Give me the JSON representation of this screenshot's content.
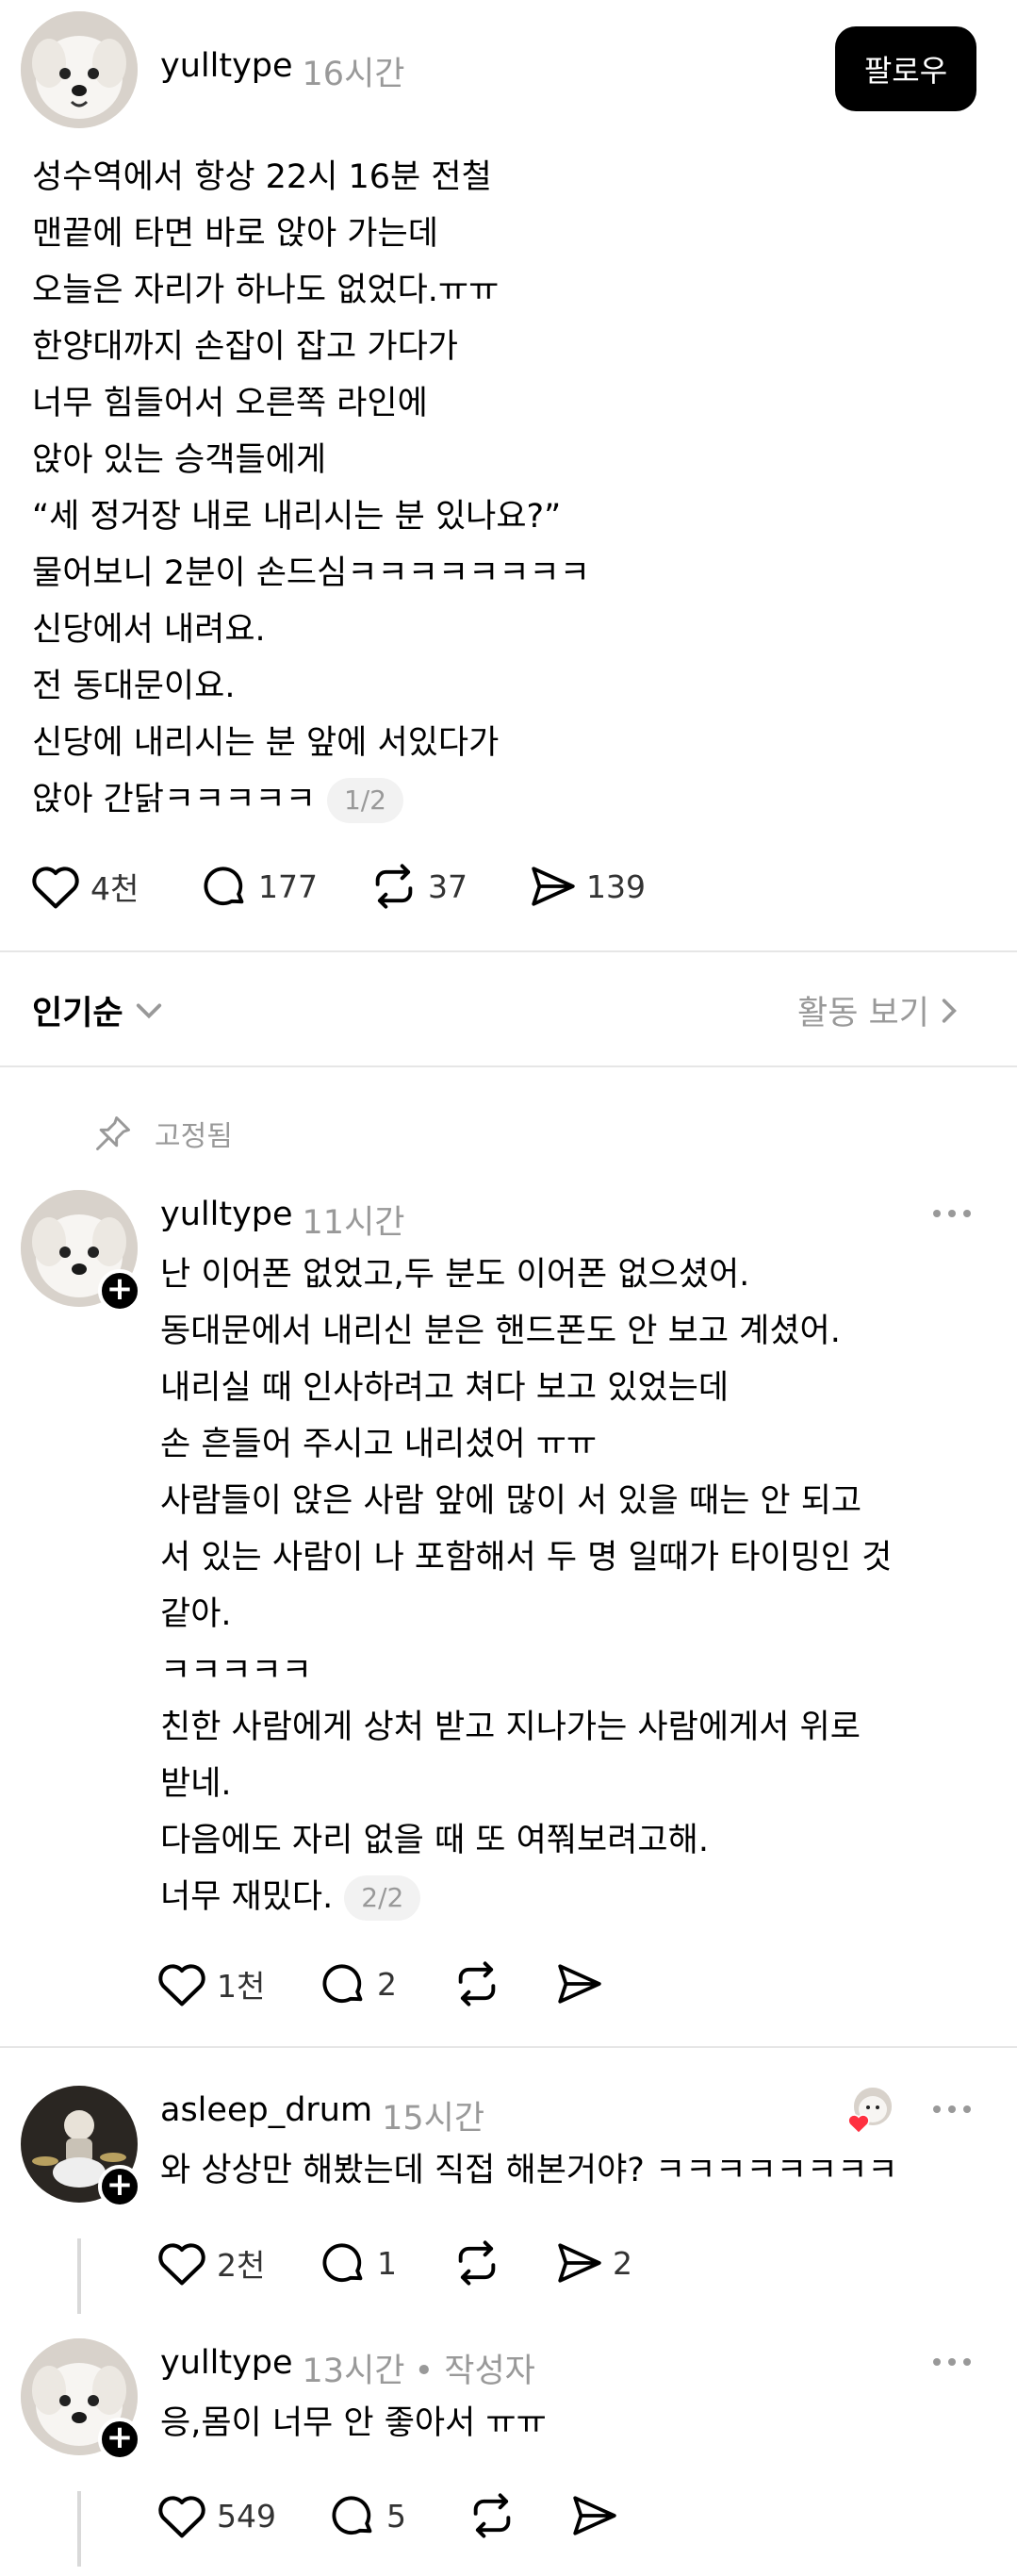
{
  "post": {
    "username": "yulltype",
    "time": "16시간",
    "follow_label": "팔로우",
    "lines": [
      "성수역에서 항상 22시 16분 전철",
      "맨끝에 타면 바로 앉아 가는데",
      "오늘은 자리가 하나도 없었다.ㅠㅠ",
      "한양대까지 손잡이 잡고 가다가",
      "너무 힘들어서 오른쪽 라인에",
      "앉아 있는 승객들에게",
      "“세 정거장 내로 내리시는 분 있나요?”",
      "물어보니 2분이 손드심ㅋㅋㅋㅋㅋㅋㅋㅋ",
      "신당에서 내려요.",
      "전 동대문이요.",
      "신당에 내리시는 분 앞에 서있다가",
      "앉아 간닭ㅋㅋㅋㅋㅋ"
    ],
    "pager": "1/2",
    "likes": "4천",
    "comments": "177",
    "reposts": "37",
    "shares": "139"
  },
  "sort_bar": {
    "sort_label": "인기순",
    "activity_label": "활동 보기"
  },
  "pinned_label": "고정됨",
  "replies": [
    {
      "username": "yulltype",
      "time": "11시간",
      "lines": [
        "난 이어폰 없었고,두 분도 이어폰 없으셨어.",
        "동대문에서 내리신 분은 핸드폰도 안 보고 계셨어.",
        "내리실 때 인사하려고 쳐다 보고 있었는데",
        "손 흔들어 주시고 내리셨어 ㅠㅠ",
        "사람들이 앉은 사람 앞에 많이 서 있을 때는 안 되고",
        "서 있는 사람이 나 포함해서 두 명 일때가 타이밍인 것",
        "같아.",
        "ㅋㅋㅋㅋㅋ",
        "친한 사람에게 상처 받고 지나가는 사람에게서 위로",
        "받네.",
        "다음에도 자리 없을 때 또 여쭤보려고해.",
        "너무 재밌다."
      ],
      "pager": "2/2",
      "likes": "1천",
      "comments": "2"
    },
    {
      "username": "asleep_drum",
      "time": "15시간",
      "text": "와 상상만 해봤는데 직접 해본거야? ㅋㅋㅋㅋㅋㅋㅋㅋ",
      "likes": "2천",
      "comments": "1",
      "shares": "2"
    },
    {
      "username": "yulltype",
      "time": "13시간",
      "author_tag": "• 작성자",
      "text": "응,몸이 너무 안 좋아서 ㅠㅠ",
      "likes": "549",
      "comments": "5"
    }
  ],
  "colors": {
    "text": "#000000",
    "muted": "#999999",
    "divider": "#e6e6e6",
    "heart_red": "#ff3040"
  }
}
